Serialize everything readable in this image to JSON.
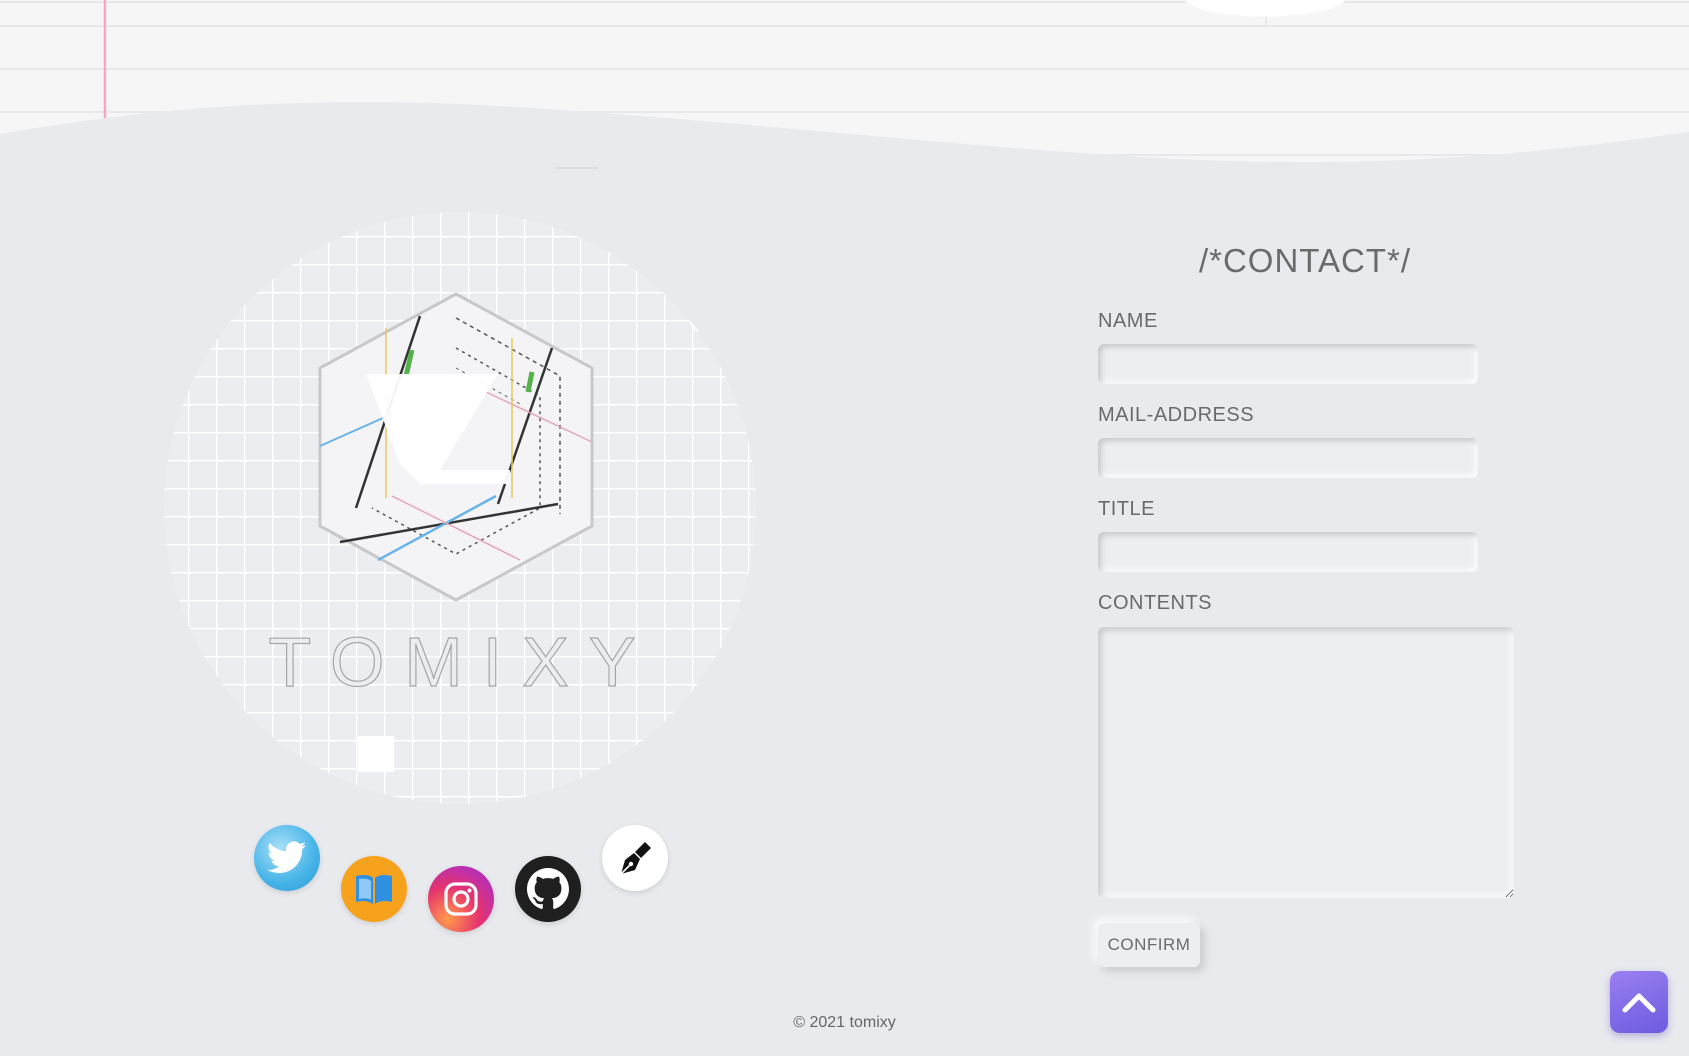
{
  "logo": {
    "wordmark": "TOMIXY"
  },
  "social": [
    {
      "name": "Twitter",
      "icon": "twitter-bird-icon",
      "color": "#45b3e8"
    },
    {
      "name": "Book",
      "icon": "open-book-icon",
      "color": "#f7a21d"
    },
    {
      "name": "Instagram",
      "icon": "instagram-camera-icon",
      "color": "#e6336e"
    },
    {
      "name": "GitHub",
      "icon": "github-octocat-icon",
      "color": "#1f1f1f"
    },
    {
      "name": "Pen",
      "icon": "fountain-pen-nib-icon",
      "color": "#ffffff"
    }
  ],
  "contact": {
    "title": "/*CONTACT*/",
    "name_label": "NAME",
    "name_value": "",
    "mail_label": "MAIL-ADDRESS",
    "mail_value": "",
    "subject_label": "TITLE",
    "subject_value": "",
    "contents_label": "CONTENTS",
    "contents_value": "",
    "confirm_label": "CONFIRM"
  },
  "footer": {
    "copyright": "© 2021 tomixy"
  },
  "back_to_top": {
    "icon": "chevron-up-icon",
    "color": "#7b66e8"
  }
}
